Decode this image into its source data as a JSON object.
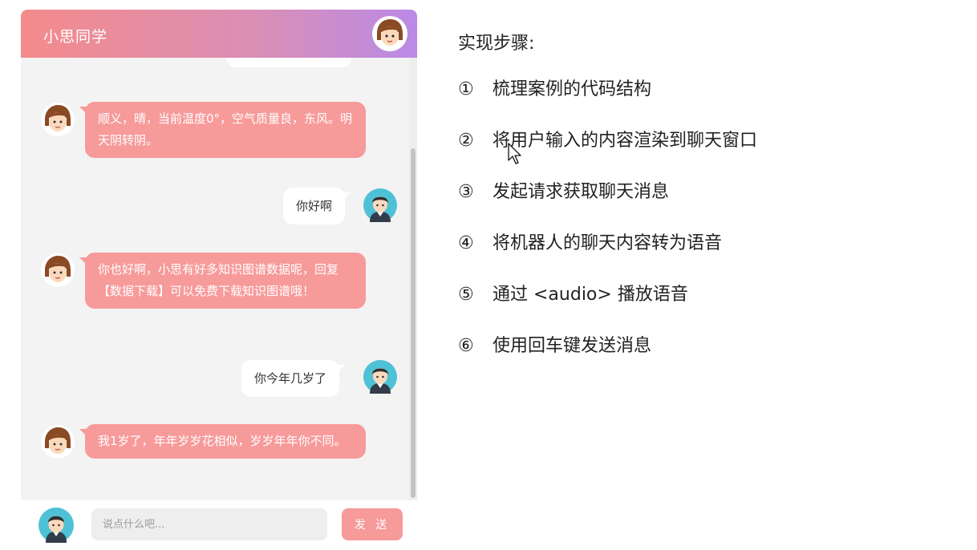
{
  "chat": {
    "title": "小思同学",
    "header_avatar": "female-robot-avatar",
    "messages": [
      {
        "role": "bot",
        "text": "顺义，晴，当前温度0°，空气质量良，东风。明天阴转阴。"
      },
      {
        "role": "user",
        "text": "你好啊"
      },
      {
        "role": "bot",
        "text": "你也好啊，小思有好多知识图谱数据呢，回复【数据下载】可以免费下载知识图谱哦！"
      },
      {
        "role": "user",
        "text": "你今年几岁了"
      },
      {
        "role": "bot",
        "text": "我1岁了，年年岁岁花相似，岁岁年年你不同。"
      }
    ],
    "input": {
      "placeholder": "说点什么吧...",
      "value": "",
      "send_label": "发 送"
    }
  },
  "steps": {
    "title": "实现步骤:",
    "items": [
      {
        "num": "①",
        "text": "梳理案例的代码结构"
      },
      {
        "num": "②",
        "text": "将用户输入的内容渲染到聊天窗口"
      },
      {
        "num": "③",
        "text": "发起请求获取聊天消息"
      },
      {
        "num": "④",
        "text": "将机器人的聊天内容转为语音"
      },
      {
        "num": "⑤",
        "text": "通过 <audio> 播放语音"
      },
      {
        "num": "⑥",
        "text": "使用回车键发送消息"
      }
    ]
  },
  "colors": {
    "header_gradient_start": "#f48b8b",
    "header_gradient_end": "#b98ae6",
    "bot_bubble": "#f79a9a",
    "user_bubble": "#ffffff",
    "send_button": "#f79a9a"
  }
}
